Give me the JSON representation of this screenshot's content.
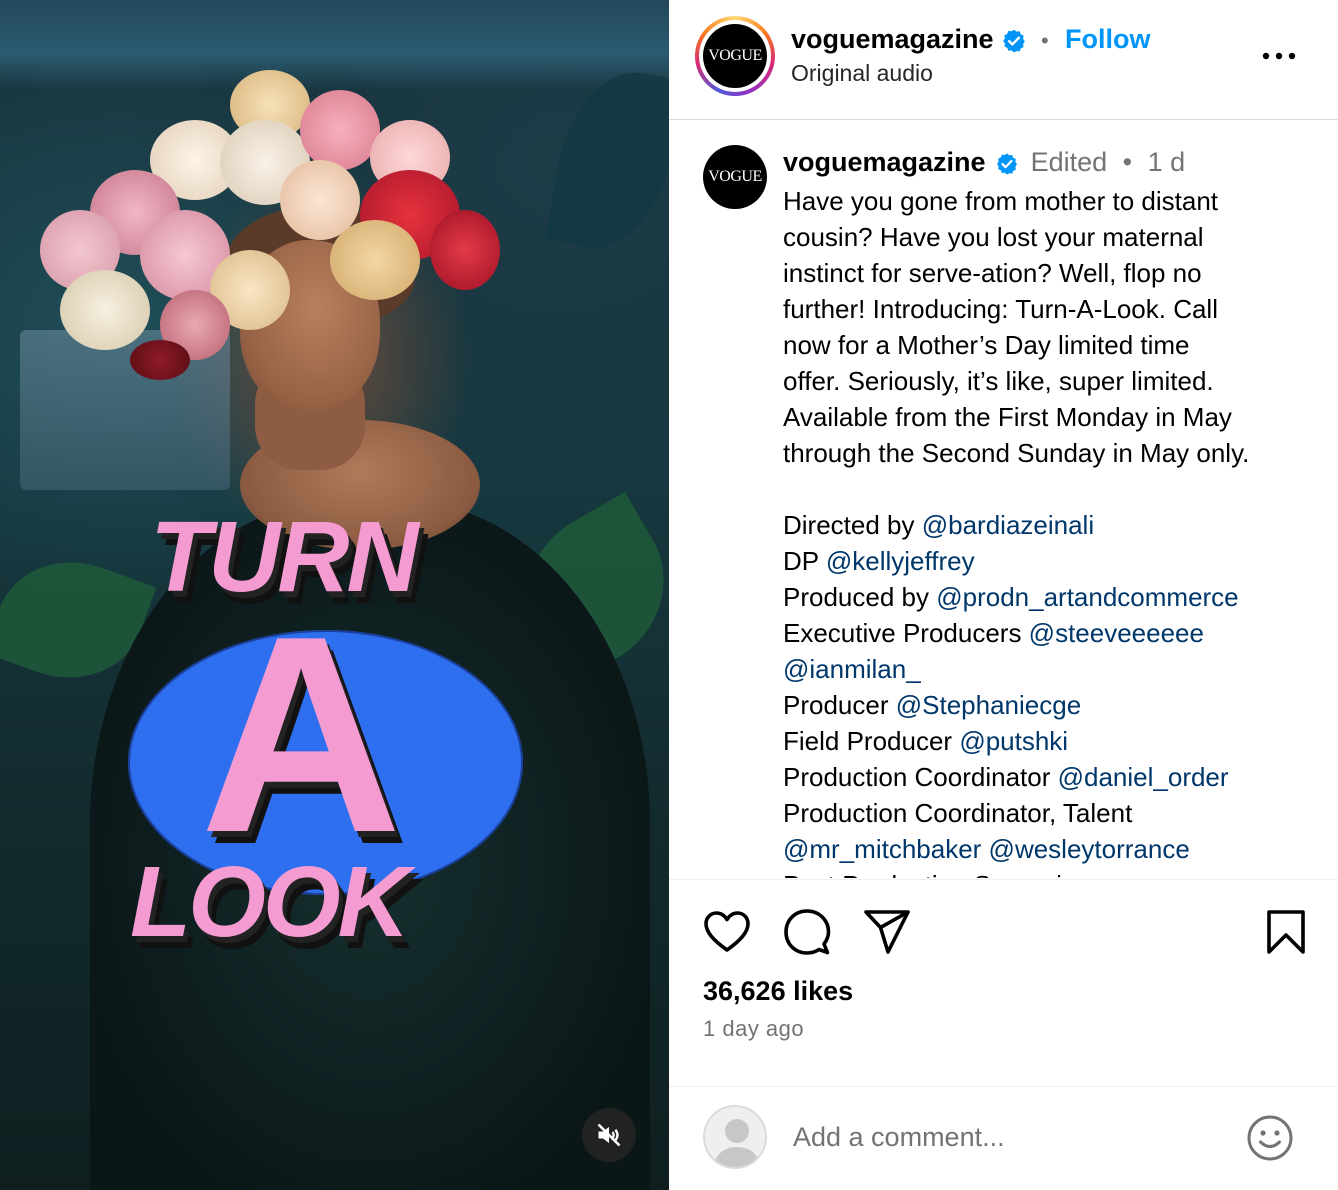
{
  "post": {
    "media": {
      "logo_line1": "TURN",
      "logo_line2": "A",
      "logo_line3": "LOOK",
      "mute_icon": "speaker-muted-icon"
    },
    "header": {
      "avatar_text": "VOGUE",
      "username": "voguemagazine",
      "separator": "•",
      "follow_label": "Follow",
      "audio": "Original audio"
    },
    "caption": {
      "username": "voguemagazine",
      "edited": "Edited",
      "separator": "•",
      "age": "1 d",
      "text_lines": [
        "Have you gone from mother to distant",
        "cousin? Have you lost your maternal",
        "instinct for serve-ation? Well, flop no",
        "further! Introducing: Turn-A-Look. Call",
        "now for a Mother’s Day limited time",
        "offer. Seriously, it’s like, super limited.",
        "Available from the First Monday in May",
        "through the Second Sunday in May only."
      ],
      "credits": [
        {
          "label": "Directed by ",
          "mention": "@bardiazeinali"
        },
        {
          "label": "DP ",
          "mention": "@kellyjeffrey"
        },
        {
          "label": "Produced by ",
          "mention": "@prodn_artandcommerce"
        },
        {
          "label": "Executive Producers ",
          "mention": "@steeveeeeee"
        },
        {
          "label": "",
          "mention": "@ianmilan_"
        },
        {
          "label": "Producer ",
          "mention": "@Stephaniecge"
        },
        {
          "label": "Field Producer ",
          "mention": "@putshki"
        },
        {
          "label": "Production Coordinator ",
          "mention": "@daniel_order"
        },
        {
          "label": "Production Coordinator, Talent",
          "mention": ""
        },
        {
          "label": "",
          "mention": "@mr_mitchbaker @wesleytorrance"
        },
        {
          "label": "Post Production Supervisor",
          "mention": ""
        }
      ]
    },
    "stats": {
      "likes": "36,626 likes",
      "time": "1 day ago"
    },
    "comment": {
      "placeholder": "Add a comment..."
    },
    "colors": {
      "follow_blue": "#0095f6",
      "mention_blue": "#00376b",
      "verified_blue": "#0095f6",
      "muted_gray": "#737373",
      "logo_pink": "#f49bd1",
      "logo_blue": "#2e6ff0"
    }
  }
}
